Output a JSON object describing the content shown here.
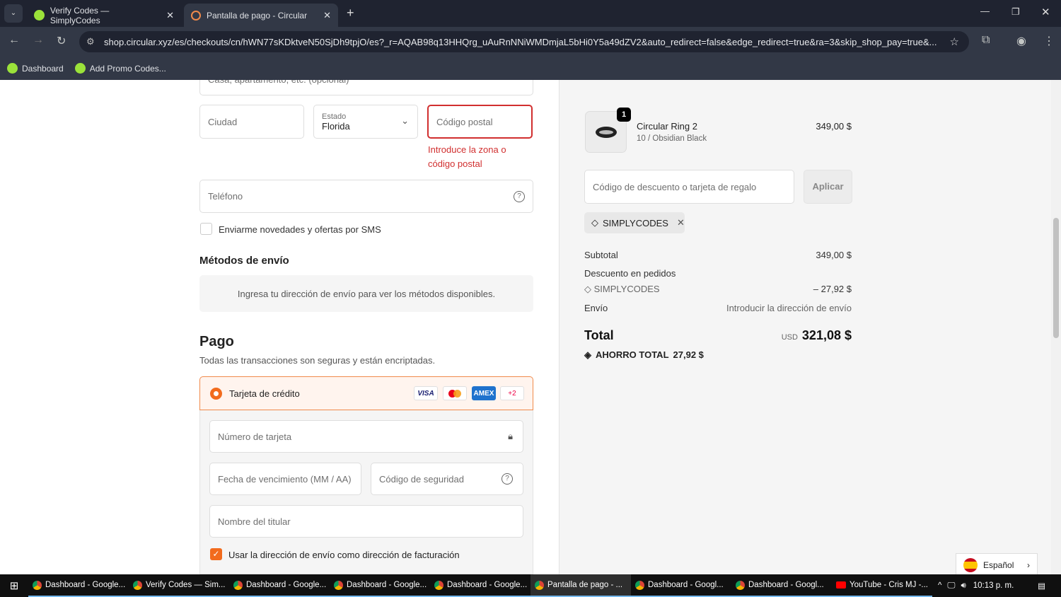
{
  "browser": {
    "tabs": [
      {
        "title": "Verify Codes — SimplyCodes",
        "active": false
      },
      {
        "title": "Pantalla de pago - Circular",
        "active": true
      }
    ],
    "url": "shop.circular.xyz/es/checkouts/cn/hWN77sKDktveN50SjDh9tpjO/es?_r=AQAB98q13HHQrg_uAuRnNNiWMDmjaL5bHi0Y5a49dZV2&auto_redirect=false&edge_redirect=true&ra=3&skip_shop_pay=true&...",
    "bookmarks": [
      "Dashboard",
      "Add Promo Codes..."
    ]
  },
  "form": {
    "address2_placeholder": "Casa, apartamento, etc. (opcional)",
    "city_placeholder": "Ciudad",
    "state_label": "Estado",
    "state_value": "Florida",
    "zip_placeholder": "Código postal",
    "zip_error": "Introduce la zona o código postal",
    "phone_placeholder": "Teléfono",
    "sms_label": "Enviarme novedades y ofertas por SMS",
    "shipping_title": "Métodos de envío",
    "shipping_notice": "Ingresa tu dirección de envío para ver los métodos disponibles.",
    "payment_title": "Pago",
    "payment_subtitle": "Todas las transacciones son seguras y están encriptadas.",
    "credit_card_label": "Tarjeta de crédito",
    "cards": [
      "VISA",
      "AMEX",
      "+2"
    ],
    "card_number_placeholder": "Número de tarjeta",
    "expiry_placeholder": "Fecha de vencimiento (MM / AA)",
    "cvv_placeholder": "Código de seguridad",
    "name_placeholder": "Nombre del titular",
    "billing_same_label": "Usar la dirección de envío como dirección de facturación"
  },
  "summary": {
    "item": {
      "qty": "1",
      "name": "Circular Ring 2",
      "variant": "10 / Obsidian Black",
      "price": "349,00 $"
    },
    "discount_placeholder": "Código de descuento o tarjeta de regalo",
    "apply_label": "Aplicar",
    "applied_code": "SIMPLYCODES",
    "subtotal_label": "Subtotal",
    "subtotal": "349,00 $",
    "order_discount_label": "Descuento en pedidos",
    "discount_code": "SIMPLYCODES",
    "discount_amount": "– 27,92 $",
    "shipping_label": "Envío",
    "shipping_value": "Introducir la dirección de envío",
    "total_label": "Total",
    "currency": "USD",
    "total": "321,08 $",
    "savings_label": "AHORRO TOTAL",
    "savings": "27,92 $"
  },
  "language": "Español",
  "taskbar": {
    "items": [
      "Dashboard - Google...",
      "Verify Codes — Sim...",
      "Dashboard - Google...",
      "Dashboard - Google...",
      "Dashboard - Google...",
      "Pantalla de pago - ...",
      "Dashboard - Googl...",
      "Dashboard - Googl...",
      "YouTube - Cris MJ -..."
    ],
    "time": "10:13 p. m."
  }
}
